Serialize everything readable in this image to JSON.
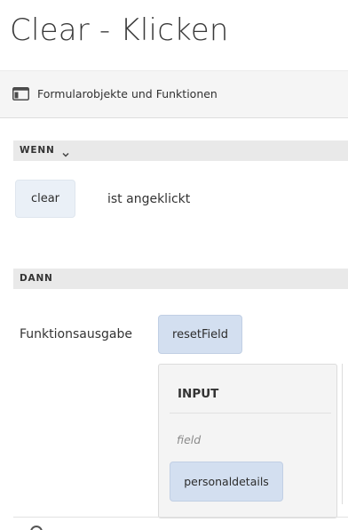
{
  "title": "Clear - Klicken",
  "toolbar": {
    "icon": "form-objects-icon",
    "label": "Formularobjekte und Funktionen"
  },
  "when_section": {
    "label": "WENN",
    "component": "clear",
    "condition": "ist angeklickt"
  },
  "then_section": {
    "label": "DANN",
    "action_label": "Funktionsausgabe",
    "function": "resetField",
    "input": {
      "title": "INPUT",
      "field_label": "field",
      "field_value": "personaldetails"
    }
  },
  "colors": {
    "toolbar_bg": "#f5f5f5",
    "section_bg": "#e9e9e9",
    "chip_light": "#eaf0f7",
    "chip_blue": "#d3dff0"
  }
}
